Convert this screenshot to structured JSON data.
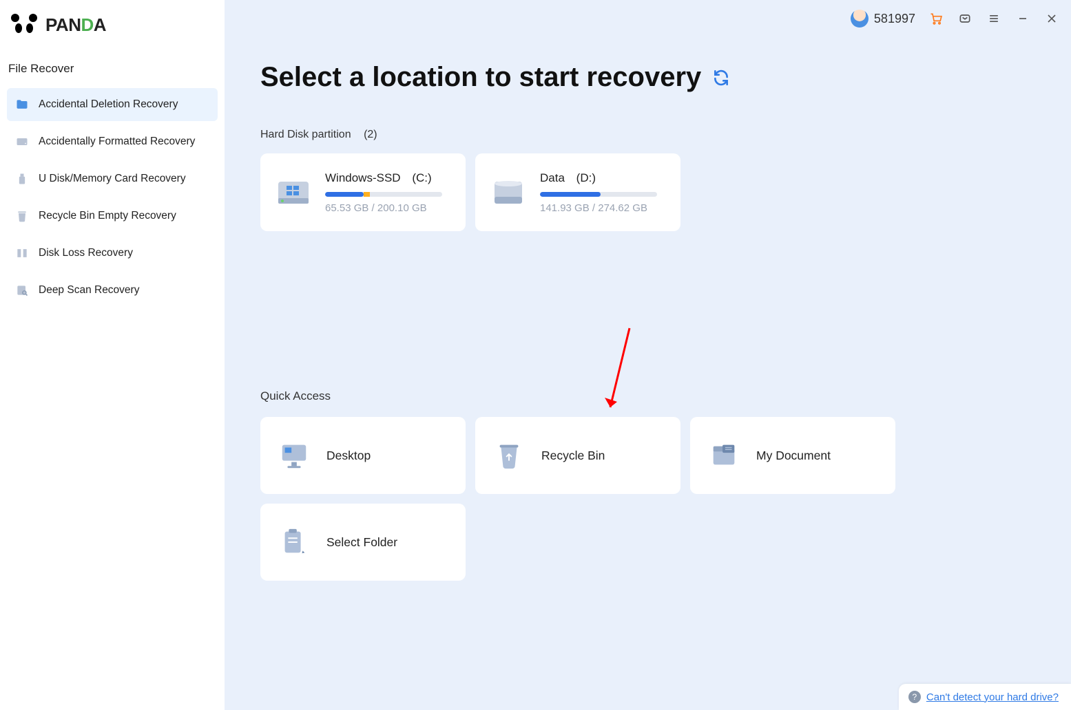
{
  "brand": {
    "name": "PANDA"
  },
  "sidebar": {
    "section_title": "File Recover",
    "items": [
      {
        "label": "Accidental Deletion Recovery",
        "active": true
      },
      {
        "label": "Accidentally Formatted Recovery",
        "active": false
      },
      {
        "label": "U Disk/Memory Card Recovery",
        "active": false
      },
      {
        "label": "Recycle Bin Empty Recovery",
        "active": false
      },
      {
        "label": "Disk Loss Recovery",
        "active": false
      },
      {
        "label": "Deep Scan Recovery",
        "active": false
      }
    ]
  },
  "topbar": {
    "user_id": "581997"
  },
  "main": {
    "title": "Select a location to start recovery",
    "partition_label": "Hard Disk partition",
    "partition_count": "(2)",
    "disks": [
      {
        "name": "Windows-SSD",
        "drive": "(C:)",
        "used": "65.53 GB",
        "total": "200.10 GB",
        "fill_pct": 33,
        "warn_start_pct": 33,
        "warn_end_pct": 38
      },
      {
        "name": "Data",
        "drive": "(D:)",
        "used": "141.93 GB",
        "total": "274.62 GB",
        "fill_pct": 52,
        "warn_start_pct": 0,
        "warn_end_pct": 0
      }
    ],
    "quick_label": "Quick Access",
    "quick": [
      {
        "label": "Desktop"
      },
      {
        "label": "Recycle Bin"
      },
      {
        "label": "My Document"
      },
      {
        "label": "Select Folder"
      }
    ]
  },
  "help": {
    "text": "Can't detect your hard drive?"
  }
}
